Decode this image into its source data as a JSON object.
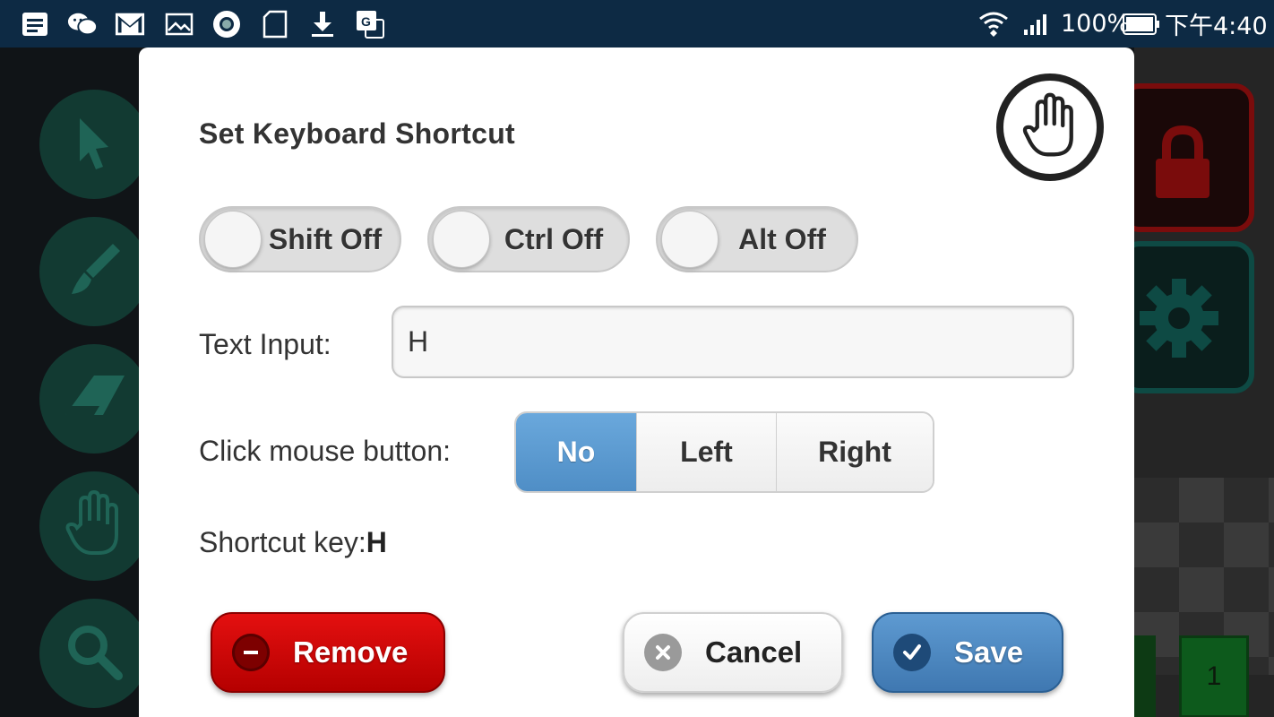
{
  "status_bar": {
    "battery": "100%",
    "time": "下午4:40",
    "icons": [
      "notes-icon",
      "wechat-icon",
      "gmail-icon",
      "gallery-icon",
      "record-icon",
      "sdcard-icon",
      "download-icon",
      "translate-icon",
      "wifi-icon",
      "signal-icon",
      "battery-icon"
    ]
  },
  "background": {
    "tools": [
      "pointer-icon",
      "brush-icon",
      "eraser-icon",
      "hand-icon",
      "magnifier-icon"
    ],
    "page_number": "1"
  },
  "dialog": {
    "title": "Set Keyboard Shortcut",
    "badge_icon": "hand-icon",
    "toggles": [
      {
        "label": "Shift Off",
        "state": "off"
      },
      {
        "label": "Ctrl Off",
        "state": "off"
      },
      {
        "label": "Alt Off",
        "state": "off"
      }
    ],
    "text_input": {
      "label": "Text Input:",
      "value": "H"
    },
    "mouse": {
      "label": "Click mouse button:",
      "options": [
        "No",
        "Left",
        "Right"
      ],
      "selected": "No"
    },
    "shortcut": {
      "label": "Shortcut key:",
      "value": "H"
    },
    "buttons": {
      "remove": "Remove",
      "cancel": "Cancel",
      "save": "Save"
    }
  },
  "colors": {
    "accent_blue": "#4f8ec6",
    "remove_red": "#d10000",
    "status_bar": "#0d2a44"
  }
}
